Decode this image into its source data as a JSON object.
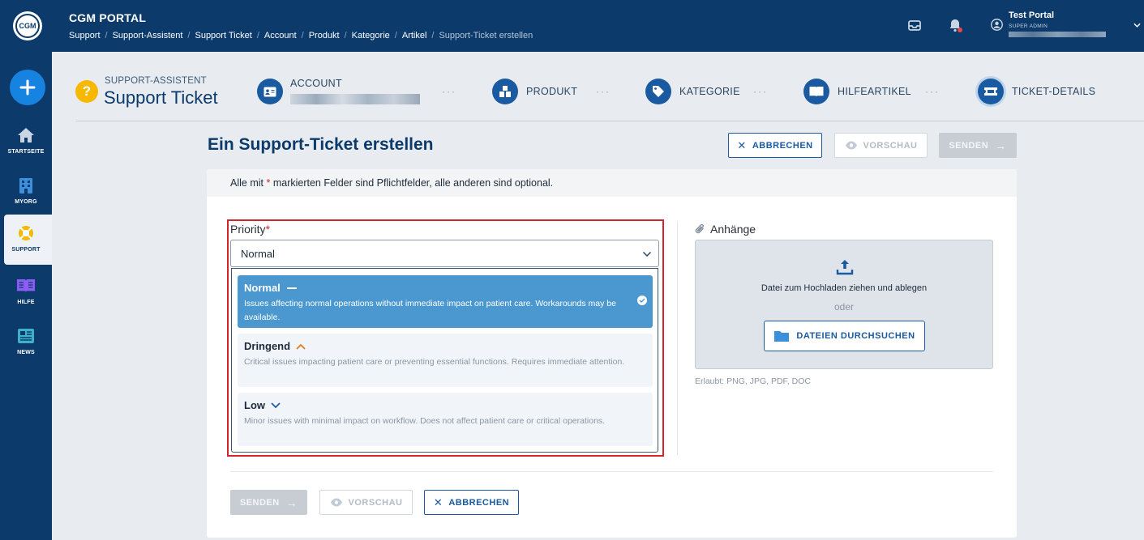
{
  "header": {
    "logo_text": "CGM",
    "app_title": "CGM PORTAL",
    "breadcrumb": [
      "Support",
      "Support-Assistent",
      "Support Ticket",
      "Account",
      "Produkt",
      "Kategorie",
      "Artikel"
    ],
    "breadcrumb_current": "Support-Ticket erstellen",
    "icons": [
      "inbox-icon",
      "bell-icon",
      "user-icon",
      "chevron-down-icon"
    ],
    "notification_dot_color": "#e5484d",
    "user": {
      "name": "Test Portal",
      "role": "SUPER ADMIN"
    }
  },
  "sidebar": {
    "add_label": "+",
    "items": [
      {
        "label": "STARTSEITE",
        "icon": "home-icon",
        "active": false
      },
      {
        "label": "MYORG",
        "icon": "building-icon",
        "active": false
      },
      {
        "label": "SUPPORT",
        "icon": "lifebuoy-icon",
        "active": true
      },
      {
        "label": "HILFE",
        "icon": "book-icon",
        "active": false
      },
      {
        "label": "NEWS",
        "icon": "newspaper-icon",
        "active": false
      }
    ]
  },
  "stepper": {
    "subtitle": "SUPPORT-ASSISTENT",
    "title": "Support Ticket",
    "help_symbol": "?",
    "dots": "···",
    "steps": [
      {
        "label": "ACCOUNT",
        "icon": "id-card-icon"
      },
      {
        "label": "PRODUKT",
        "icon": "boxes-icon"
      },
      {
        "label": "KATEGORIE",
        "icon": "tag-icon"
      },
      {
        "label": "HILFEARTIKEL",
        "icon": "open-book-icon"
      },
      {
        "label": "TICKET-DETAILS",
        "icon": "ticket-icon",
        "current": true
      }
    ]
  },
  "page": {
    "title": "Ein Support-Ticket erstellen",
    "actions": {
      "cancel": "ABBRECHEN",
      "preview": "VORSCHAU",
      "send": "SENDEN"
    },
    "required_note_before": "Alle mit",
    "required_note_star": "*",
    "required_note_after": "markierten Felder sind Pflichtfelder, alle anderen sind optional."
  },
  "priority": {
    "label": "Priority",
    "required_star": "*",
    "selected": "Normal",
    "options": [
      {
        "title": "Normal",
        "indicator": "—",
        "description": "Issues affecting normal operations without immediate impact on patient care. Workarounds may be available.",
        "selected": true
      },
      {
        "title": "Dringend",
        "indicator": "^",
        "description": "Critical issues impacting patient care or preventing essential functions. Requires immediate attention.",
        "selected": false
      },
      {
        "title": "Low",
        "indicator": "v",
        "description": "Minor issues with minimal impact on workflow. Does not affect patient care or critical operations.",
        "selected": false
      }
    ]
  },
  "attachments": {
    "label": "Anhänge",
    "drop_text": "Datei zum Hochladen ziehen und ablegen",
    "or_text": "oder",
    "browse_label": "DATEIEN DURCHSUCHEN",
    "allowed": "Erlaubt: PNG, JPG, PDF, DOC"
  },
  "colors": {
    "primary": "#0c3a6b",
    "accent": "#1a5aa0",
    "selected_option": "#4a98cf",
    "required": "#d3242b",
    "urgent_indicator": "#e07b1a",
    "help_badge": "#f6b800"
  }
}
